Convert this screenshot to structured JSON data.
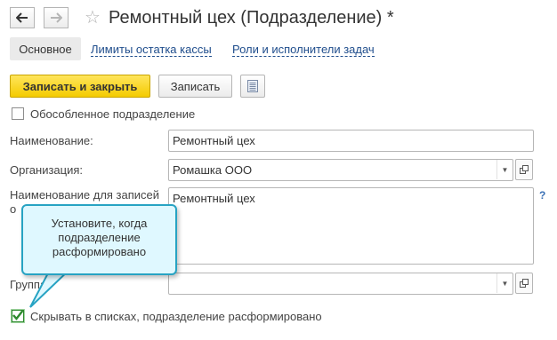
{
  "header": {
    "title": "Ремонтный цех (Подразделение) *"
  },
  "tabs": [
    {
      "label": "Основное"
    },
    {
      "label": "Лимиты остатка кассы"
    },
    {
      "label": "Роли и исполнители задач"
    }
  ],
  "toolbar": {
    "save_close_label": "Записать и закрыть",
    "save_label": "Записать"
  },
  "form": {
    "separate_label": "Обособленное подразделение",
    "name_label": "Наименование:",
    "name_value": "Ремонтный цех",
    "org_label": "Организация:",
    "org_value": "Ромашка ООО",
    "records_label_line1": "Наименование для записей",
    "records_label_line2": "о",
    "records_value": "Ремонтный цех",
    "help_mark": "?",
    "group_label": "Группа",
    "group_value": "",
    "hide_label": "Скрывать в списках, подразделение расформировано",
    "hide_checked": true
  },
  "tooltip": {
    "line1": "Установите, когда",
    "line2": "подразделение",
    "line3": "расформировано"
  },
  "colors": {
    "accent": "#f4cb00",
    "link": "#1f4d8c",
    "tooltip_bg": "#dff8ff",
    "tooltip_border": "#27a3c3",
    "check": "#2d8a2d"
  }
}
